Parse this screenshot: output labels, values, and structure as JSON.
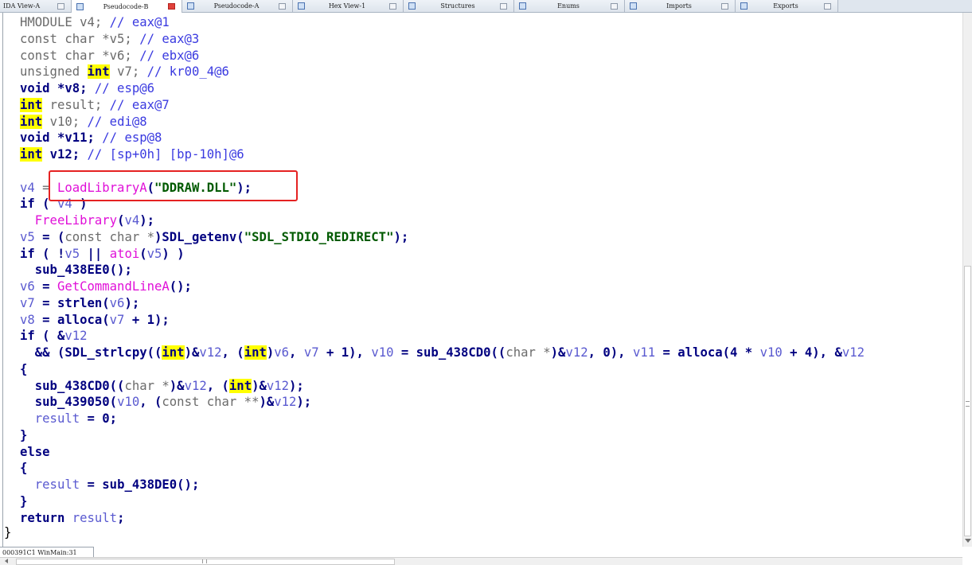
{
  "tabs": [
    {
      "label": "IDA View-A",
      "active": false
    },
    {
      "label": "Pseudocode-B",
      "active": true
    },
    {
      "label": "Pseudocode-A",
      "active": false
    },
    {
      "label": "Hex View-1",
      "active": false
    },
    {
      "label": "Structures",
      "active": false
    },
    {
      "label": "Enums",
      "active": false
    },
    {
      "label": "Imports",
      "active": false
    },
    {
      "label": "Exports",
      "active": false
    }
  ],
  "code": {
    "l1": {
      "type": "HMODULE",
      "var": "v4;",
      "cm": "// eax@1"
    },
    "l2": {
      "type": "const char *v5;",
      "cm": "// eax@3"
    },
    "l3": {
      "type": "const char *v6;",
      "cm": "// ebx@6"
    },
    "l4": {
      "a": "unsigned",
      "b": "int",
      "c": "v7;",
      "cm": "// kr00_4@6"
    },
    "l5": {
      "a": "void *v8;",
      "cm": "// esp@6"
    },
    "l6": {
      "a": "int",
      "b": "result;",
      "cm": "// eax@7"
    },
    "l7": {
      "a": "int",
      "b": "v10;",
      "cm": "// edi@8"
    },
    "l8": {
      "a": "void *v11;",
      "cm": "// esp@8"
    },
    "l9": {
      "a": "int",
      "b": "v12;",
      "cm": "// [sp+0h] [bp-10h]@6"
    },
    "l10": {
      "a": "v4",
      "b": " = ",
      "fn": "LoadLibraryA",
      "str": "\"DDRAW.DLL\"",
      "end": ");"
    },
    "l11": {
      "a": "if (",
      "b": " v4 ",
      "c": ")"
    },
    "l12": {
      "fn": "FreeLibrary",
      "arg": "v4",
      "end": ");"
    },
    "l13": {
      "a": "v5",
      "b": " = (",
      "c": "const char *",
      "d": ")SDL_getenv(",
      "str": "\"SDL_STDIO_REDIRECT\"",
      "end": ");"
    },
    "l14": {
      "a": "if ( !",
      "v": "v5",
      "b": " || ",
      "fn": "atoi",
      "c": "(",
      "v2": "v5",
      "end": ") )"
    },
    "l15": {
      "a": "sub_438EE0();"
    },
    "l16": {
      "a": "v6",
      "b": " = ",
      "fn": "GetCommandLineA",
      "end": "();"
    },
    "l17": {
      "a": "v7",
      "b": " = strlen(",
      "v": "v6",
      "end": ");"
    },
    "l18": {
      "a": "v8",
      "b": " = alloca(",
      "v": "v7",
      "end": " + 1);"
    },
    "l19": {
      "a": "if ( &",
      "v": "v12"
    },
    "l20": {
      "a": "  && (SDL_strlcpy((",
      "hl": "int",
      "b": ")&",
      "v": "v12",
      "c": ", (",
      "hl2": "int",
      "d": ")",
      "v2": "v6",
      "e": ", ",
      "v3": "v7",
      "f": " + 1), ",
      "v4": "v10",
      "g": " = sub_438CD0((",
      "h": "char *",
      "i": ")&",
      "v5": "v12",
      "j": ", 0), ",
      "v6": "v11",
      "k": " = alloca(4 * ",
      "v7": "v10",
      "l": " + 4), &",
      "v8": "v12"
    },
    "l21": {
      "a": "{"
    },
    "l22": {
      "a": "sub_438CD0((",
      "b": "char *",
      "c": ")&",
      "v": "v12",
      "d": ", (",
      "hl": "int",
      "e": ")&",
      "v2": "v12",
      "end": ");"
    },
    "l23": {
      "a": "sub_439050(",
      "v": "v10",
      "b": ", (",
      "c": "const char **",
      "d": ")&",
      "v2": "v12",
      "end": ");"
    },
    "l24": {
      "a": "result",
      "b": " = 0;"
    },
    "l25": {
      "a": "}"
    },
    "l26": {
      "a": "else"
    },
    "l27": {
      "a": "{"
    },
    "l28": {
      "a": "result",
      "b": " = sub_438DE0();"
    },
    "l29": {
      "a": "}"
    },
    "l30": {
      "a": "return",
      "b": "result",
      "end": ";"
    },
    "l31": {
      "a": "}"
    }
  },
  "status": {
    "text": "000391C1 WinMain:31"
  },
  "colors": {
    "highlight": "#ffff00",
    "redbox": "#e52222",
    "function": "#e010d8",
    "string": "#005a00"
  }
}
